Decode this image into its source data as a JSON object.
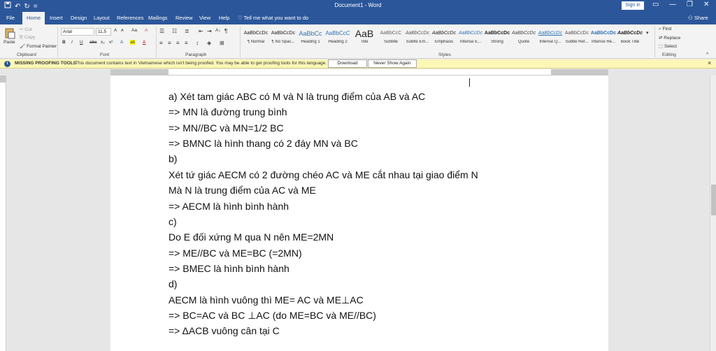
{
  "titlebar": {
    "title": "Document1 - Word",
    "sign_in": "Sign in",
    "qat": {
      "save_icon": "save-icon",
      "undo_glyph": "↶",
      "redo_glyph": "↻",
      "customize_glyph": "="
    }
  },
  "tabs": [
    "File",
    "Home",
    "Insert",
    "Design",
    "Layout",
    "References",
    "Mailings",
    "Review",
    "View",
    "Help"
  ],
  "tell_me": "Tell me what you want to do",
  "share": "Share",
  "clipboard": {
    "paste": "Paste",
    "cut": "Cut",
    "copy": "Copy",
    "format_painter": "Format Painter",
    "group": "Clipboard"
  },
  "font": {
    "name": "Arial",
    "size": "11,5",
    "group": "Font",
    "bold": "B",
    "italic": "I",
    "underline": "U",
    "strike": "abc",
    "subscript": "x₂",
    "superscript": "x²",
    "grow": "A",
    "shrink": "A",
    "case": "Aa",
    "clear": "A",
    "effects": "A",
    "highlight": "ab",
    "color": "A"
  },
  "paragraph": {
    "group": "Paragraph",
    "show_marks": "¶",
    "sort": "A↓"
  },
  "styles": {
    "group": "Styles",
    "items": [
      {
        "preview": "AaBbCcDc",
        "name": "¶ Normal"
      },
      {
        "preview": "AaBbCcDc",
        "name": "¶ No Spac..."
      },
      {
        "preview": "AaBbCc",
        "name": "Heading 1"
      },
      {
        "preview": "AaBbCcC",
        "name": "Heading 2"
      },
      {
        "preview": "AaB",
        "name": "Title"
      },
      {
        "preview": "AaBbCcC",
        "name": "Subtitle"
      },
      {
        "preview": "AaBbCcDc",
        "name": "Subtle Em..."
      },
      {
        "preview": "AaBbCcDc",
        "name": "Emphasis"
      },
      {
        "preview": "AaBbCcDc",
        "name": "Intense E..."
      },
      {
        "preview": "AaBbCcDc",
        "name": "Strong"
      },
      {
        "preview": "AaBbCcDc",
        "name": "Quote"
      },
      {
        "preview": "AaBbCcDc",
        "name": "Intense Q..."
      },
      {
        "preview": "AaBbCcDc",
        "name": "Subtle Ref..."
      },
      {
        "preview": "AaBbCcDc",
        "name": "Intense Re..."
      },
      {
        "preview": "AaBbCcDc",
        "name": "Book Title"
      }
    ]
  },
  "editing": {
    "group": "Editing",
    "find": "Find",
    "replace": "Replace",
    "select": "Select"
  },
  "message_bar": {
    "title": "MISSING PROOFING TOOLS",
    "text": "This document contains text in Vietnamese which isn't being proofed. You may be able to get proofing tools for this language.",
    "download": "Download",
    "never_show": "Never Show Again"
  },
  "document": {
    "lines": [
      "a) Xét tam giác ABC có M và N là trung điểm của AB và AC",
      "=> MN là đường trung bình",
      "=> MN//BC và MN=1/2 BC",
      "=> BMNC là hình thang có 2 đáy MN và BC",
      "b)",
      "Xét tứ giác AECM có 2 đường chéo AC và ME cắt nhau tại giao điểm N",
      "Mà N là trung điểm của AC và ME",
      "=> AECM là hình bình hành",
      "c)",
      "Do E đối xứng M qua N nên ME=2MN",
      "=> ME//BC và ME=BC (=2MN)",
      "=> BMEC là hình bình hành",
      "d)",
      "AECM là hình vuông thì ME= AC và ME⊥AC",
      "=> BC=AC và BC ⊥AC (do ME=BC và ME//BC)",
      "=> ΔACB vuông cân tại C"
    ]
  },
  "colors": {
    "accent": "#2b579a",
    "ribbon": "#f3f3f3",
    "message": "#fcf7b6"
  }
}
